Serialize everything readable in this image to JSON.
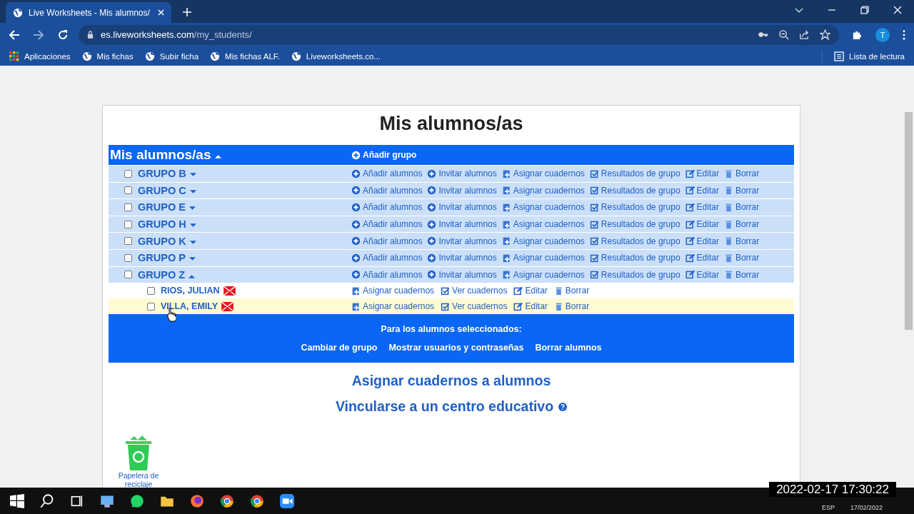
{
  "browser": {
    "tab": {
      "title": "Live Worksheets - Mis alumnos/"
    },
    "url": {
      "host": "es.liveworksheets.com",
      "path": "/my_students/"
    },
    "avatar": "T",
    "bookmarks": [
      {
        "label": "Aplicaciones",
        "kind": "apps"
      },
      {
        "label": "Mis fichas",
        "kind": "site"
      },
      {
        "label": "Subir ficha",
        "kind": "site"
      },
      {
        "label": "Mis fichas ALF.",
        "kind": "site"
      },
      {
        "label": "Liveworksheets.co...",
        "kind": "site"
      }
    ],
    "reading_list": "Lista de lectura"
  },
  "page": {
    "title": "Mis alumnos/as",
    "table": {
      "header": "Mis alumnos/as",
      "add_group": "Añadir grupo",
      "groups": [
        {
          "name": "GRUPO B",
          "checked": false,
          "expanded": false,
          "actions": [
            "Añadir alumnos",
            "Invitar alumnos",
            "Asignar cuadernos",
            "Resultados de grupo",
            "Editar",
            "Borrar"
          ]
        },
        {
          "name": "GRUPO C",
          "checked": false,
          "expanded": false,
          "actions": [
            "Añadir alumnos",
            "Invitar alumnos",
            "Asignar cuadernos",
            "Resultados de grupo",
            "Editar",
            "Borrar"
          ]
        },
        {
          "name": "GRUPO E",
          "checked": false,
          "expanded": false,
          "actions": [
            "Añadir alumnos",
            "Invitar alumnos",
            "Asignar cuadernos",
            "Resultados de grupo",
            "Editar",
            "Borrar"
          ]
        },
        {
          "name": "GRUPO H",
          "checked": false,
          "expanded": false,
          "actions": [
            "Añadir alumnos",
            "Invitar alumnos",
            "Asignar cuadernos",
            "Resultados de grupo",
            "Editar",
            "Borrar"
          ]
        },
        {
          "name": "GRUPO K",
          "checked": false,
          "expanded": false,
          "actions": [
            "Añadir alumnos",
            "Invitar alumnos",
            "Asignar cuadernos",
            "Resultados de grupo",
            "Editar",
            "Borrar"
          ]
        },
        {
          "name": "GRUPO P",
          "checked": false,
          "expanded": false,
          "actions": [
            "Añadir alumnos",
            "Invitar alumnos",
            "Asignar cuadernos",
            "Resultados de grupo",
            "Editar",
            "Borrar"
          ]
        },
        {
          "name": "GRUPO Z",
          "checked": false,
          "expanded": true,
          "actions": [
            "Añadir alumnos",
            "Invitar alumnos",
            "Asignar cuadernos",
            "Resultados de grupo",
            "Editar",
            "Borrar"
          ],
          "students": [
            {
              "name": "RIOS, JULIAN",
              "checked": false,
              "highlighted": false,
              "actions": [
                "Asignar cuadernos",
                "Ver cuadernos",
                "Editar",
                "Borrar"
              ]
            },
            {
              "name": "VILLA, EMILY",
              "checked": false,
              "highlighted": true,
              "actions": [
                "Asignar cuadernos",
                "Ver cuadernos",
                "Editar",
                "Borrar"
              ]
            }
          ]
        }
      ],
      "selected_bar": {
        "title": "Para los alumnos seleccionados:",
        "actions": [
          "Cambiar de grupo",
          "Mostrar usuarios y contraseñas",
          "Borrar alumnos"
        ]
      }
    },
    "links": [
      "Asignar cuadernos a alumnos",
      "Vincularse a un centro educativo"
    ]
  },
  "desktop_icon": {
    "label": "Papelera de reciclaje"
  },
  "taskbar": {
    "language": "ESP",
    "date": "17/02/2022"
  },
  "video_timestamp": "2022-02-17 17:30:22"
}
